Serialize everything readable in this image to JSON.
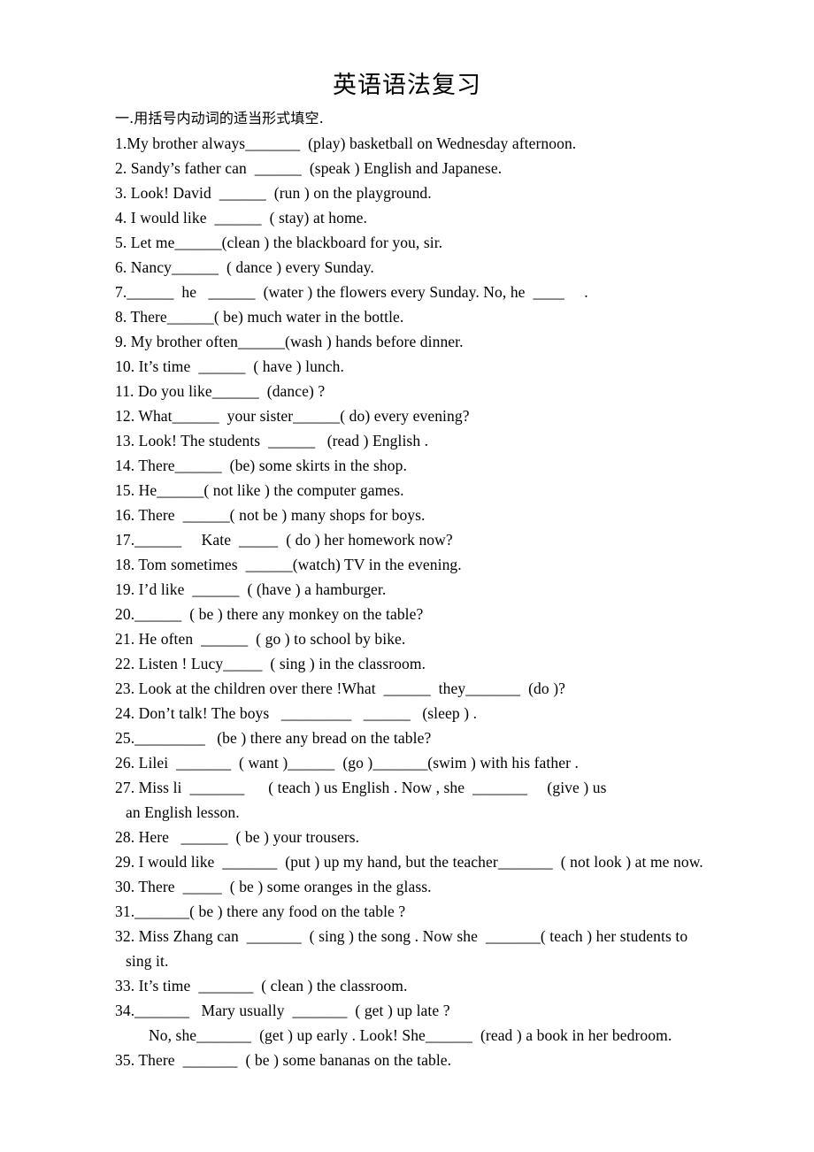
{
  "document": {
    "title": "英语语法复习",
    "section_heading": "一.用括号内动词的适当形式填空.",
    "lines": [
      {
        "id": "q1",
        "text": "1.My brother always_______  (play) basketball on Wednesday afternoon.",
        "indent": 0
      },
      {
        "id": "q2",
        "text": "2. Sandy’s father can  ______  (speak ) English and Japanese.",
        "indent": 0
      },
      {
        "id": "q3",
        "text": "3. Look! David  ______  (run ) on the playground.",
        "indent": 0
      },
      {
        "id": "q4",
        "text": "4. I would like  ______  ( stay) at home.",
        "indent": 0
      },
      {
        "id": "q5",
        "text": "5. Let me______(clean ) the blackboard for you, sir.",
        "indent": 0
      },
      {
        "id": "q6",
        "text": "6. Nancy______  ( dance ) every Sunday.",
        "indent": 0
      },
      {
        "id": "q7",
        "text": "7.______  he   ______  (water ) the flowers every Sunday. No, he  ____     .",
        "indent": 0
      },
      {
        "id": "q8",
        "text": "8. There______( be) much water in the bottle.",
        "indent": 0
      },
      {
        "id": "q9",
        "text": "9. My brother often______(wash ) hands before dinner.",
        "indent": 0
      },
      {
        "id": "q10",
        "text": "10. It’s time  ______  ( have ) lunch.",
        "indent": 0
      },
      {
        "id": "q11",
        "text": "11. Do you like______  (dance) ?",
        "indent": 0
      },
      {
        "id": "q12",
        "text": "12. What______  your sister______( do) every evening?",
        "indent": 0
      },
      {
        "id": "q13",
        "text": "13. Look! The students  ______   (read ) English .",
        "indent": 0
      },
      {
        "id": "q14",
        "text": "14. There______  (be) some skirts in the shop.",
        "indent": 0
      },
      {
        "id": "q15",
        "text": "15. He______( not like ) the computer games.",
        "indent": 0
      },
      {
        "id": "q16",
        "text": "16. There  ______( not be ) many shops for boys.",
        "indent": 0
      },
      {
        "id": "q17",
        "text": "17.______     Kate  _____  ( do ) her homework now?",
        "indent": 0
      },
      {
        "id": "q18",
        "text": "18. Tom sometimes  ______(watch) TV in the evening.",
        "indent": 0
      },
      {
        "id": "q19",
        "text": "19. I’d like  ______  ( (have ) a hamburger.",
        "indent": 0
      },
      {
        "id": "q20",
        "text": "20.______  ( be ) there any monkey on the table?",
        "indent": 0
      },
      {
        "id": "q21",
        "text": "21. He often  ______  ( go ) to school by bike.",
        "indent": 0
      },
      {
        "id": "q22",
        "text": "22. Listen ! Lucy_____  ( sing ) in the classroom.",
        "indent": 0
      },
      {
        "id": "q23",
        "text": "23. Look at the children over there !What  ______  they_______  (do )?",
        "indent": 0
      },
      {
        "id": "q24",
        "text": "24. Don’t talk! The boys   _________   ______   (sleep ) .",
        "indent": 0
      },
      {
        "id": "q25",
        "text": "25._________   (be ) there any bread on the table?",
        "indent": 0
      },
      {
        "id": "q26",
        "text": "26. Lilei  _______  ( want )______  (go )_______(swim ) with his father .",
        "indent": 0
      },
      {
        "id": "q27",
        "text": "27. Miss li  _______      ( teach ) us English . Now , she  _______     (give ) us",
        "indent": 0
      },
      {
        "id": "q27b",
        "text": "an English lesson.",
        "indent": 1
      },
      {
        "id": "q28",
        "text": "28. Here   ______  ( be ) your trousers.",
        "indent": 0
      },
      {
        "id": "q29",
        "text": "29. I would like  _______  (put ) up my hand, but the teacher_______  ( not look ) at me now.",
        "indent": 0
      },
      {
        "id": "q30",
        "text": "30. There  _____  ( be ) some oranges in the glass.",
        "indent": 0
      },
      {
        "id": "q31",
        "text": "31._______( be ) there any food on the table ?",
        "indent": 0
      },
      {
        "id": "q32",
        "text": "32. Miss Zhang can  _______  ( sing ) the song . Now she  _______( teach ) her students to",
        "indent": 0
      },
      {
        "id": "q32b",
        "text": "sing it.",
        "indent": 1
      },
      {
        "id": "q33",
        "text": "33. It’s time  _______  ( clean ) the classroom.",
        "indent": 0
      },
      {
        "id": "q34",
        "text": "34._______   Mary usually  _______  ( get ) up late ?",
        "indent": 0
      },
      {
        "id": "q34b",
        "text": "No, she_______  (get ) up early . Look! She______  (read ) a book in her bedroom.",
        "indent": 2
      },
      {
        "id": "q35",
        "text": "35. There  _______  ( be ) some bananas on the table.",
        "indent": 0
      }
    ]
  }
}
